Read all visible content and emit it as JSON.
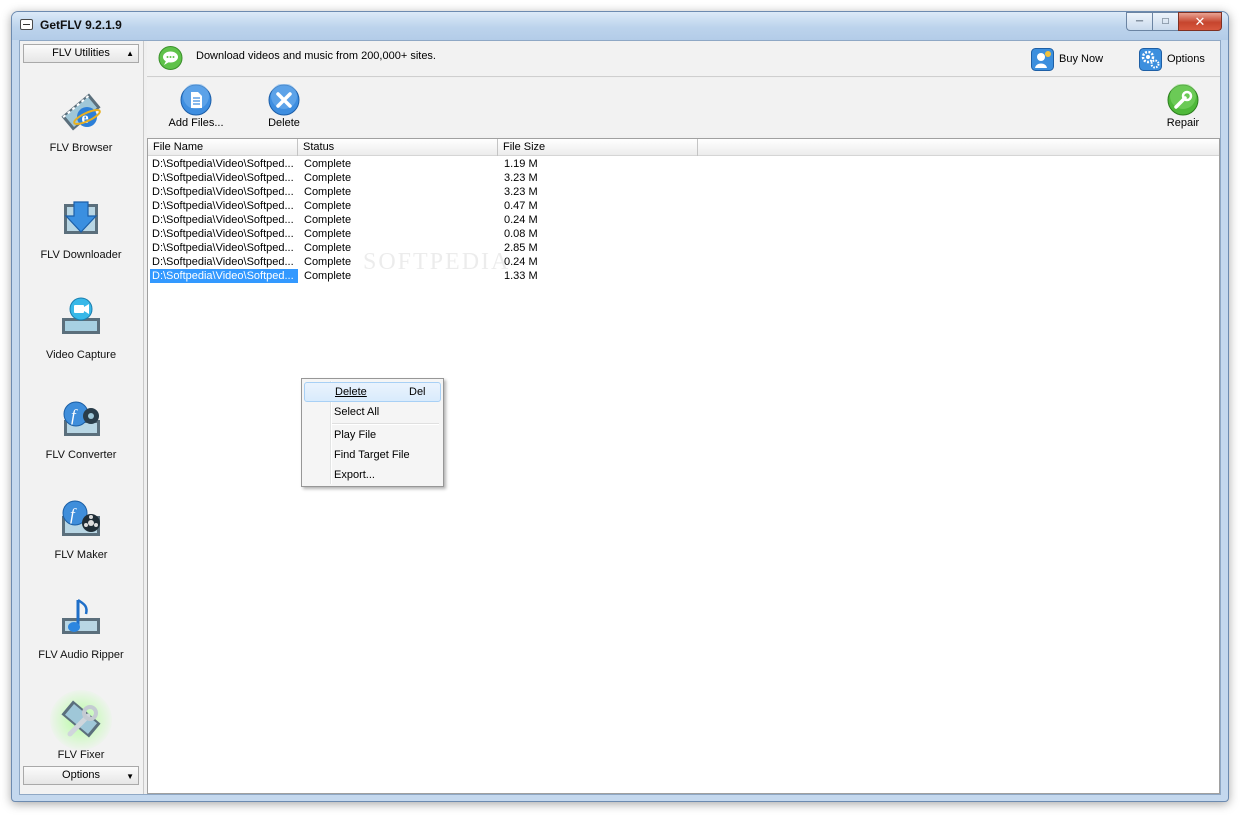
{
  "window": {
    "title": "GetFLV 9.2.1.9"
  },
  "sidebar": {
    "header": "FLV Utilities",
    "footer": "Options",
    "items": [
      {
        "label": "FLV Browser",
        "icon": "flv-browser-icon"
      },
      {
        "label": "FLV Downloader",
        "icon": "flv-downloader-icon"
      },
      {
        "label": "Video Capture",
        "icon": "video-capture-icon"
      },
      {
        "label": "FLV Converter",
        "icon": "flv-converter-icon"
      },
      {
        "label": "FLV Maker",
        "icon": "flv-maker-icon"
      },
      {
        "label": "FLV Audio Ripper",
        "icon": "flv-audio-ripper-icon"
      },
      {
        "label": "FLV Fixer",
        "icon": "flv-fixer-icon",
        "active": true
      }
    ]
  },
  "topbar": {
    "tagline": "Download videos and music from 200,000+ sites.",
    "buy_now": "Buy Now",
    "options": "Options"
  },
  "toolbar": {
    "add_files": "Add Files...",
    "delete": "Delete",
    "repair": "Repair"
  },
  "list": {
    "columns": [
      "File Name",
      "Status",
      "File Size"
    ],
    "rows": [
      {
        "name": "D:\\Softpedia\\Video\\Softped...",
        "status": "Complete",
        "size": "1.19 M"
      },
      {
        "name": "D:\\Softpedia\\Video\\Softped...",
        "status": "Complete",
        "size": "3.23 M"
      },
      {
        "name": "D:\\Softpedia\\Video\\Softped...",
        "status": "Complete",
        "size": "3.23 M"
      },
      {
        "name": "D:\\Softpedia\\Video\\Softped...",
        "status": "Complete",
        "size": "0.47 M"
      },
      {
        "name": "D:\\Softpedia\\Video\\Softped...",
        "status": "Complete",
        "size": "0.24 M"
      },
      {
        "name": "D:\\Softpedia\\Video\\Softped...",
        "status": "Complete",
        "size": "0.08 M"
      },
      {
        "name": "D:\\Softpedia\\Video\\Softped...",
        "status": "Complete",
        "size": "2.85 M"
      },
      {
        "name": "D:\\Softpedia\\Video\\Softped...",
        "status": "Complete",
        "size": "0.24 M"
      },
      {
        "name": "D:\\Softpedia\\Video\\Softped...",
        "status": "Complete",
        "size": "1.33 M",
        "selected": true
      }
    ]
  },
  "context_menu": {
    "delete": "Delete",
    "delete_key": "Del",
    "select_all": "Select All",
    "play_file": "Play File",
    "find_target": "Find Target File",
    "export": "Export..."
  },
  "colors": {
    "selection": "#3399ff",
    "accent": "#1e73c8"
  }
}
